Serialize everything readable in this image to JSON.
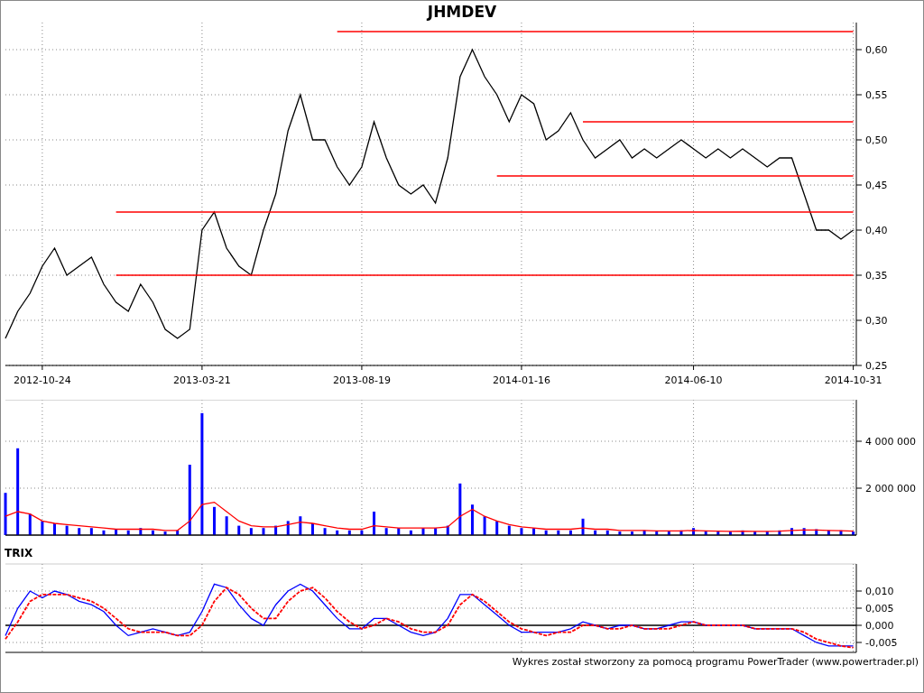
{
  "price_panel": {
    "chart_data": {
      "type": "line",
      "title": "JHMDEV",
      "grid": true,
      "ylim": [
        0.25,
        0.632
      ],
      "categories": [
        null,
        null,
        null,
        "2012-10-24",
        null,
        null,
        null,
        null,
        null,
        null,
        null,
        null,
        null,
        null,
        null,
        null,
        "2013-03-21",
        null,
        null,
        null,
        null,
        null,
        null,
        null,
        null,
        null,
        null,
        null,
        null,
        "2013-08-19",
        null,
        null,
        null,
        null,
        null,
        null,
        null,
        null,
        null,
        null,
        null,
        null,
        "2014-01-16",
        null,
        null,
        null,
        null,
        null,
        null,
        null,
        null,
        null,
        null,
        null,
        null,
        null,
        "2014-06-10",
        null,
        null,
        null,
        null,
        null,
        null,
        null,
        null,
        null,
        null,
        null,
        null,
        "2014-10-31"
      ],
      "yticks": [
        {
          "value": 0.6,
          "label": "0,60"
        },
        {
          "value": 0.55,
          "label": "0,55"
        },
        {
          "value": 0.5,
          "label": "0,50"
        },
        {
          "value": 0.45,
          "label": "0,45"
        },
        {
          "value": 0.4,
          "label": "0,40"
        },
        {
          "value": 0.35,
          "label": "0,35"
        },
        {
          "value": 0.3,
          "label": "0,30"
        },
        {
          "value": 0.25,
          "label": "0,25"
        }
      ],
      "series": [
        {
          "color": "#000000",
          "values": [
            0.28,
            0.31,
            0.33,
            0.36,
            0.38,
            0.35,
            0.36,
            0.37,
            0.34,
            0.32,
            0.31,
            0.34,
            0.32,
            0.29,
            0.28,
            0.29,
            0.4,
            0.42,
            0.38,
            0.36,
            0.35,
            0.4,
            0.44,
            0.51,
            0.55,
            0.5,
            0.5,
            0.47,
            0.45,
            0.47,
            0.52,
            0.48,
            0.45,
            0.44,
            0.45,
            0.43,
            0.48,
            0.57,
            0.6,
            0.57,
            0.55,
            0.52,
            0.55,
            0.54,
            0.5,
            0.51,
            0.53,
            0.5,
            0.48,
            0.49,
            0.5,
            0.48,
            0.49,
            0.48,
            0.49,
            0.5,
            0.49,
            0.48,
            0.49,
            0.48,
            0.49,
            0.48,
            0.47,
            0.48,
            0.48,
            0.44,
            0.4,
            0.4,
            0.39,
            0.4
          ]
        },
        {
          "color": "#ff0000",
          "values": [
            null,
            null,
            null,
            null,
            null,
            null,
            null,
            null,
            null,
            null,
            null,
            null,
            null,
            null,
            null,
            null,
            null,
            null,
            null,
            null,
            null,
            null,
            null,
            null,
            null,
            null,
            null,
            0.62,
            0.62,
            0.62,
            0.62,
            0.62,
            0.62,
            0.62,
            0.62,
            0.62,
            0.62,
            0.62,
            0.62,
            0.62,
            0.62,
            0.62,
            0.62,
            0.62,
            0.62,
            0.62,
            0.62,
            0.62,
            0.62,
            0.62,
            0.62,
            0.62,
            0.62,
            0.62,
            0.62,
            0.62,
            0.62,
            0.62,
            0.62,
            0.62,
            0.62,
            0.62,
            0.62,
            0.62,
            0.62,
            0.62,
            0.62,
            0.62,
            0.62,
            0.62
          ]
        },
        {
          "color": "#ff0000",
          "values": [
            null,
            null,
            null,
            null,
            null,
            null,
            null,
            null,
            null,
            null,
            null,
            null,
            null,
            null,
            null,
            null,
            null,
            null,
            null,
            null,
            null,
            null,
            null,
            null,
            null,
            null,
            null,
            null,
            null,
            null,
            null,
            null,
            null,
            null,
            null,
            null,
            null,
            null,
            null,
            null,
            null,
            null,
            null,
            null,
            null,
            null,
            null,
            0.52,
            0.52,
            0.52,
            0.52,
            0.52,
            0.52,
            0.52,
            0.52,
            0.52,
            0.52,
            0.52,
            0.52,
            0.52,
            0.52,
            0.52,
            0.52,
            0.52,
            0.52,
            0.52,
            0.52,
            0.52,
            0.52,
            0.52
          ]
        },
        {
          "color": "#ff0000",
          "values": [
            null,
            null,
            null,
            null,
            null,
            null,
            null,
            null,
            null,
            null,
            null,
            null,
            null,
            null,
            null,
            null,
            null,
            null,
            null,
            null,
            null,
            null,
            null,
            null,
            null,
            null,
            null,
            null,
            null,
            null,
            null,
            null,
            null,
            null,
            null,
            null,
            null,
            null,
            null,
            null,
            0.46,
            0.46,
            0.46,
            0.46,
            0.46,
            0.46,
            0.46,
            0.46,
            0.46,
            0.46,
            0.46,
            0.46,
            0.46,
            0.46,
            0.46,
            0.46,
            0.46,
            0.46,
            0.46,
            0.46,
            0.46,
            0.46,
            0.46,
            0.46,
            0.46,
            0.46,
            0.46,
            0.46,
            0.46,
            0.46
          ]
        },
        {
          "color": "#ff0000",
          "values": [
            null,
            null,
            null,
            null,
            null,
            null,
            null,
            null,
            null,
            0.42,
            0.42,
            0.42,
            0.42,
            0.42,
            0.42,
            0.42,
            0.42,
            0.42,
            0.42,
            0.42,
            0.42,
            0.42,
            0.42,
            0.42,
            0.42,
            0.42,
            0.42,
            0.42,
            0.42,
            0.42,
            0.42,
            0.42,
            0.42,
            0.42,
            0.42,
            0.42,
            0.42,
            0.42,
            0.42,
            0.42,
            0.42,
            0.42,
            0.42,
            0.42,
            0.42,
            0.42,
            0.42,
            0.42,
            0.42,
            0.42,
            0.42,
            0.42,
            0.42,
            0.42,
            0.42,
            0.42,
            0.42,
            0.42,
            0.42,
            0.42,
            0.42,
            0.42,
            0.42,
            0.42,
            0.42,
            0.42,
            0.42,
            0.42,
            0.42,
            0.42
          ]
        },
        {
          "color": "#ff0000",
          "values": [
            null,
            null,
            null,
            null,
            null,
            null,
            null,
            null,
            null,
            0.35,
            0.35,
            0.35,
            0.35,
            0.35,
            0.35,
            0.35,
            0.35,
            0.35,
            0.35,
            0.35,
            0.35,
            0.35,
            0.35,
            0.35,
            0.35,
            0.35,
            0.35,
            0.35,
            0.35,
            0.35,
            0.35,
            0.35,
            0.35,
            0.35,
            0.35,
            0.35,
            0.35,
            0.35,
            0.35,
            0.35,
            0.35,
            0.35,
            0.35,
            0.35,
            0.35,
            0.35,
            0.35,
            0.35,
            0.35,
            0.35,
            0.35,
            0.35,
            0.35,
            0.35,
            0.35,
            0.35,
            0.35,
            0.35,
            0.35,
            0.35,
            0.35,
            0.35,
            0.35,
            0.35,
            0.35,
            0.35,
            0.35,
            0.35,
            0.35,
            0.35
          ]
        }
      ]
    }
  },
  "volume_panel": {
    "chart_data": {
      "type": "bar",
      "grid": true,
      "ylim": [
        0,
        5770000
      ],
      "categories": [
        null,
        null,
        null,
        null,
        null,
        null,
        null,
        null,
        null,
        null,
        null,
        null,
        null,
        null,
        null,
        null,
        null,
        null,
        null,
        null,
        null,
        null,
        null,
        null,
        null,
        null,
        null,
        null,
        null,
        null,
        null,
        null,
        null,
        null,
        null,
        null,
        null,
        null,
        null,
        null,
        null,
        null,
        null,
        null,
        null,
        null,
        null,
        null,
        null,
        null,
        null,
        null,
        null,
        null,
        null,
        null,
        null,
        null,
        null,
        null,
        null,
        null,
        null,
        null,
        null,
        null,
        null,
        null,
        null,
        null
      ],
      "yticks": [
        {
          "value": 4000000,
          "label": "4 000 000"
        },
        {
          "value": 2000000,
          "label": "2 000 000"
        }
      ],
      "series": [
        {
          "color": "#0000ff",
          "values": [
            1800000,
            3700000,
            900000,
            600000,
            500000,
            400000,
            300000,
            300000,
            200000,
            250000,
            200000,
            300000,
            200000,
            150000,
            200000,
            3000000,
            5200000,
            1200000,
            800000,
            400000,
            300000,
            300000,
            400000,
            600000,
            800000,
            500000,
            300000,
            200000,
            200000,
            200000,
            1000000,
            300000,
            300000,
            200000,
            300000,
            300000,
            400000,
            2200000,
            1300000,
            800000,
            600000,
            400000,
            300000,
            300000,
            200000,
            200000,
            200000,
            700000,
            200000,
            200000,
            150000,
            150000,
            200000,
            150000,
            150000,
            200000,
            300000,
            150000,
            150000,
            150000,
            200000,
            150000,
            150000,
            200000,
            300000,
            300000,
            250000,
            200000,
            200000,
            150000
          ]
        }
      ]
    }
  },
  "volume_average": {
    "chart_data": {
      "type": "line",
      "ylim": [
        0,
        5770000
      ],
      "categories": [
        null,
        null,
        null,
        null,
        null,
        null,
        null,
        null,
        null,
        null,
        null,
        null,
        null,
        null,
        null,
        null,
        null,
        null,
        null,
        null,
        null,
        null,
        null,
        null,
        null,
        null,
        null,
        null,
        null,
        null,
        null,
        null,
        null,
        null,
        null,
        null,
        null,
        null,
        null,
        null,
        null,
        null,
        null,
        null,
        null,
        null,
        null,
        null,
        null,
        null,
        null,
        null,
        null,
        null,
        null,
        null,
        null,
        null,
        null,
        null,
        null,
        null,
        null,
        null,
        null,
        null,
        null,
        null,
        null,
        null
      ],
      "series": [
        {
          "color": "#ff0000",
          "values": [
            800000,
            1000000,
            900000,
            600000,
            500000,
            450000,
            400000,
            350000,
            300000,
            250000,
            250000,
            250000,
            250000,
            200000,
            200000,
            600000,
            1300000,
            1400000,
            1000000,
            600000,
            400000,
            350000,
            350000,
            450000,
            550000,
            500000,
            400000,
            300000,
            250000,
            250000,
            400000,
            350000,
            300000,
            300000,
            300000,
            300000,
            350000,
            800000,
            1100000,
            800000,
            600000,
            450000,
            350000,
            300000,
            250000,
            250000,
            250000,
            300000,
            250000,
            250000,
            200000,
            200000,
            200000,
            180000,
            180000,
            180000,
            200000,
            180000,
            170000,
            160000,
            170000,
            160000,
            160000,
            170000,
            200000,
            220000,
            220000,
            200000,
            190000,
            170000
          ]
        }
      ]
    }
  },
  "trix_panel": {
    "chart_data": {
      "type": "line",
      "title": "TRIX",
      "grid": true,
      "ylim": [
        -0.0079,
        0.0179
      ],
      "categories": [
        null,
        null,
        null,
        null,
        null,
        null,
        null,
        null,
        null,
        null,
        null,
        null,
        null,
        null,
        null,
        null,
        null,
        null,
        null,
        null,
        null,
        null,
        null,
        null,
        null,
        null,
        null,
        null,
        null,
        null,
        null,
        null,
        null,
        null,
        null,
        null,
        null,
        null,
        null,
        null,
        null,
        null,
        null,
        null,
        null,
        null,
        null,
        null,
        null,
        null,
        null,
        null,
        null,
        null,
        null,
        null,
        null,
        null,
        null,
        null,
        null,
        null,
        null,
        null,
        null,
        null,
        null,
        null,
        null,
        null
      ],
      "yticks": [
        {
          "value": 0.01,
          "label": "0,010"
        },
        {
          "value": 0.005,
          "label": "0,005"
        },
        {
          "value": 0,
          "label": "0,000"
        },
        {
          "value": -0.005,
          "label": "-0,005"
        }
      ],
      "series": [
        {
          "color": "#0000ff",
          "values": [
            -0.003,
            0.005,
            0.01,
            0.008,
            0.01,
            0.009,
            0.007,
            0.006,
            0.004,
            0.0,
            -0.003,
            -0.002,
            -0.001,
            -0.002,
            -0.003,
            -0.002,
            0.004,
            0.012,
            0.011,
            0.006,
            0.002,
            0.0,
            0.006,
            0.01,
            0.012,
            0.01,
            0.006,
            0.002,
            -0.001,
            -0.001,
            0.002,
            0.002,
            0.0,
            -0.002,
            -0.003,
            -0.002,
            0.002,
            0.009,
            0.009,
            0.006,
            0.003,
            0.0,
            -0.002,
            -0.002,
            -0.002,
            -0.002,
            -0.001,
            0.001,
            0.0,
            -0.001,
            0.0,
            0.0,
            -0.001,
            -0.001,
            0.0,
            0.001,
            0.001,
            0.0,
            0.0,
            0.0,
            0.0,
            -0.001,
            -0.001,
            -0.001,
            -0.001,
            -0.003,
            -0.005,
            -0.006,
            -0.006,
            -0.006
          ]
        },
        {
          "color": "#ff0000",
          "line_style": "dashed",
          "values": [
            -0.004,
            0.001,
            0.007,
            0.009,
            0.009,
            0.009,
            0.008,
            0.007,
            0.005,
            0.002,
            -0.001,
            -0.002,
            -0.002,
            -0.002,
            -0.003,
            -0.003,
            0.0,
            0.007,
            0.011,
            0.009,
            0.005,
            0.002,
            0.002,
            0.007,
            0.01,
            0.011,
            0.008,
            0.004,
            0.001,
            -0.001,
            0.0,
            0.002,
            0.001,
            -0.001,
            -0.002,
            -0.002,
            0.0,
            0.006,
            0.009,
            0.007,
            0.004,
            0.001,
            -0.001,
            -0.002,
            -0.003,
            -0.002,
            -0.002,
            0.0,
            0.0,
            -0.001,
            -0.001,
            0.0,
            -0.001,
            -0.001,
            -0.001,
            0.0,
            0.001,
            0.0,
            0.0,
            0.0,
            0.0,
            -0.001,
            -0.001,
            -0.001,
            -0.001,
            -0.002,
            -0.004,
            -0.005,
            -0.006,
            -0.0065
          ]
        }
      ]
    }
  },
  "footer": "Wykres został stworzony za pomocą programu PowerTrader (www.powertrader.pl)"
}
